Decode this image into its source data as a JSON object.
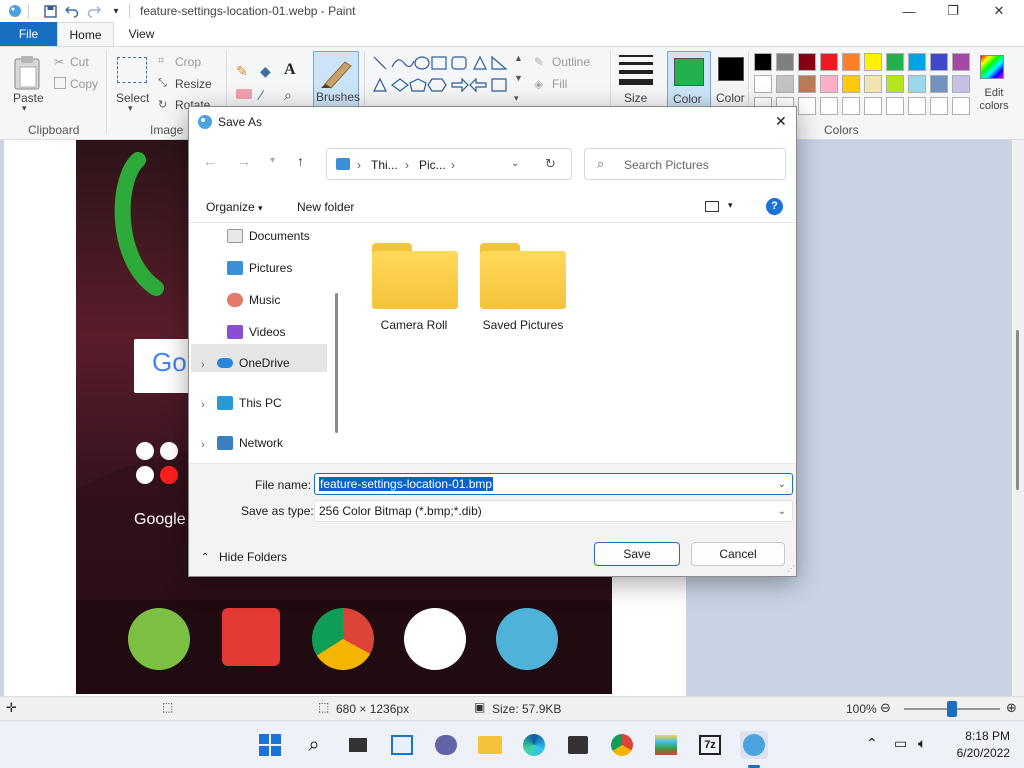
{
  "window": {
    "title": "feature-settings-location-01.webp - Paint",
    "minimize": "—",
    "maximize": "❐",
    "close": "✕"
  },
  "ribbon_tabs": {
    "file": "File",
    "home": "Home",
    "view": "View"
  },
  "ribbon": {
    "paste": "Paste",
    "cut": "Cut",
    "copy": "Copy",
    "clipboard_group": "Clipboard",
    "select": "Select",
    "crop": "Crop",
    "resize": "Resize",
    "rotate": "Rotate",
    "image_group": "Image",
    "brushes": "Brushes",
    "outline": "Outline",
    "fill": "Fill",
    "size": "Size",
    "color1": "Color",
    "color2": "Color",
    "colors_group": "Colors",
    "edit_colors": "Edit colors",
    "palette_row1": [
      "#000000",
      "#7f7f7f",
      "#880015",
      "#ed1c24",
      "#ff7f27",
      "#fff200",
      "#22b14c",
      "#00a2e8",
      "#3f48cc",
      "#a349a4"
    ],
    "palette_row2": [
      "#ffffff",
      "#c3c3c3",
      "#b97a57",
      "#ffaec9",
      "#ffc90e",
      "#efe4b0",
      "#b5e61d",
      "#99d9ea",
      "#7092be",
      "#c8bfe7"
    ],
    "color1_value": "#22b14c",
    "color2_value": "#000000"
  },
  "dialog": {
    "title": "Save As",
    "close": "✕",
    "breadcrumb": [
      "Thi...",
      "Pic..."
    ],
    "search_placeholder": "Search Pictures",
    "organize": "Organize",
    "new_folder": "New folder",
    "help": "?",
    "tree": [
      {
        "label": "Documents",
        "pinned": true
      },
      {
        "label": "Pictures",
        "pinned": true
      },
      {
        "label": "Music",
        "pinned": false
      },
      {
        "label": "Videos",
        "pinned": false
      },
      {
        "label": "OneDrive",
        "pinned": false
      },
      {
        "label": "This PC",
        "pinned": false
      },
      {
        "label": "Network",
        "pinned": false
      }
    ],
    "folders": [
      "Camera Roll",
      "Saved Pictures"
    ],
    "file_name_label": "File name:",
    "file_name_value": "feature-settings-location-01.bmp",
    "save_as_type_label": "Save as type:",
    "save_as_type_value": "256 Color Bitmap (*.bmp;*.dib)",
    "hide_folders": "Hide Folders",
    "save": "Save",
    "cancel": "Cancel"
  },
  "canvas": {
    "google_label": "Google",
    "search_partial": "Go"
  },
  "statusbar": {
    "dimensions": "680 × 1236px",
    "size": "Size: 57.9KB",
    "zoom": "100%",
    "zoom_level": 0.5
  },
  "taskbar": {
    "time": "8:18 PM",
    "date": "6/20/2022"
  }
}
